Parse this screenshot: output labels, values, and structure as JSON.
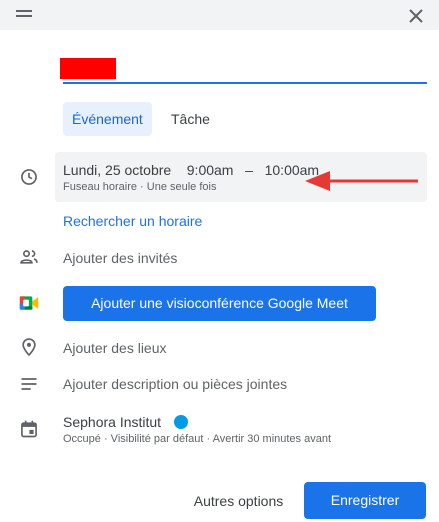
{
  "tabs": {
    "event": "Événement",
    "task": "Tâche"
  },
  "datetime": {
    "date": "Lundi, 25 octobre",
    "start": "9:00am",
    "dash": "–",
    "end": "10:00am",
    "sub": "Fuseau horaire · Une seule fois"
  },
  "find_time": "Rechercher un horaire",
  "guests": "Ajouter des invités",
  "meet_button": "Ajouter une visioconférence Google Meet",
  "location": "Ajouter des lieux",
  "description": "Ajouter description ou pièces jointes",
  "calendar": {
    "name": "Sephora Institut",
    "details": "Occupé · Visibilité par défaut · Avertir 30 minutes avant"
  },
  "footer": {
    "more": "Autres options",
    "save": "Enregistrer"
  },
  "colors": {
    "accent": "#1a73e8",
    "title_redaction": "#ff0000",
    "calendar_dot": "#039be5",
    "annotation_arrow": "#e53935"
  },
  "icons": {
    "drag": "drag-handle-icon",
    "close": "close-icon",
    "time": "clock-icon",
    "guests": "people-icon",
    "meet": "google-meet-icon",
    "location": "location-pin-icon",
    "description": "notes-icon",
    "calendar": "calendar-icon",
    "annotation": "red-arrow-icon"
  }
}
